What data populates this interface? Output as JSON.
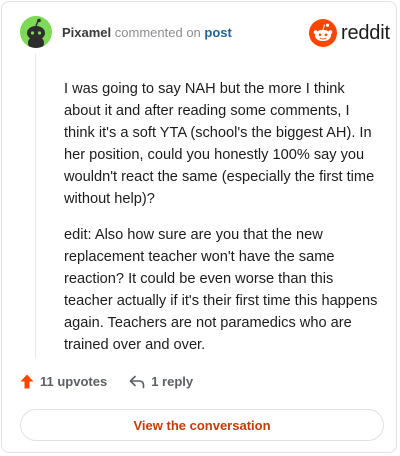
{
  "comment": {
    "username": "Pixamel",
    "action_text": "commented on",
    "post_link": "post",
    "paragraphs": [
      "I was going to say NAH but the more I think about it and after reading some comments, I think it's a soft YTA (school's the biggest AH). In her position, could you honestly 100% say you wouldn't react the same (especially the first time without help)?",
      "edit: Also how sure are you that the new replacement teacher won't have the same reaction? It could be even worse than this teacher actually if it's their first time this happens again. Teachers are not paramedics who are trained over and over."
    ]
  },
  "logo": {
    "text": "reddit",
    "icon": "reddit-snoo-icon",
    "color": "#ff4500"
  },
  "actions": {
    "upvotes": "11 upvotes",
    "upvote_icon": "upvote-arrow-icon",
    "upvote_color": "#ff4500",
    "replies": "1 reply",
    "reply_icon": "reply-arrow-icon"
  },
  "conversation_button": {
    "label": "View the conversation",
    "color": "#c23b0a"
  },
  "avatar": {
    "icon": "snoo-avatar-icon",
    "color": "#7ed957"
  }
}
